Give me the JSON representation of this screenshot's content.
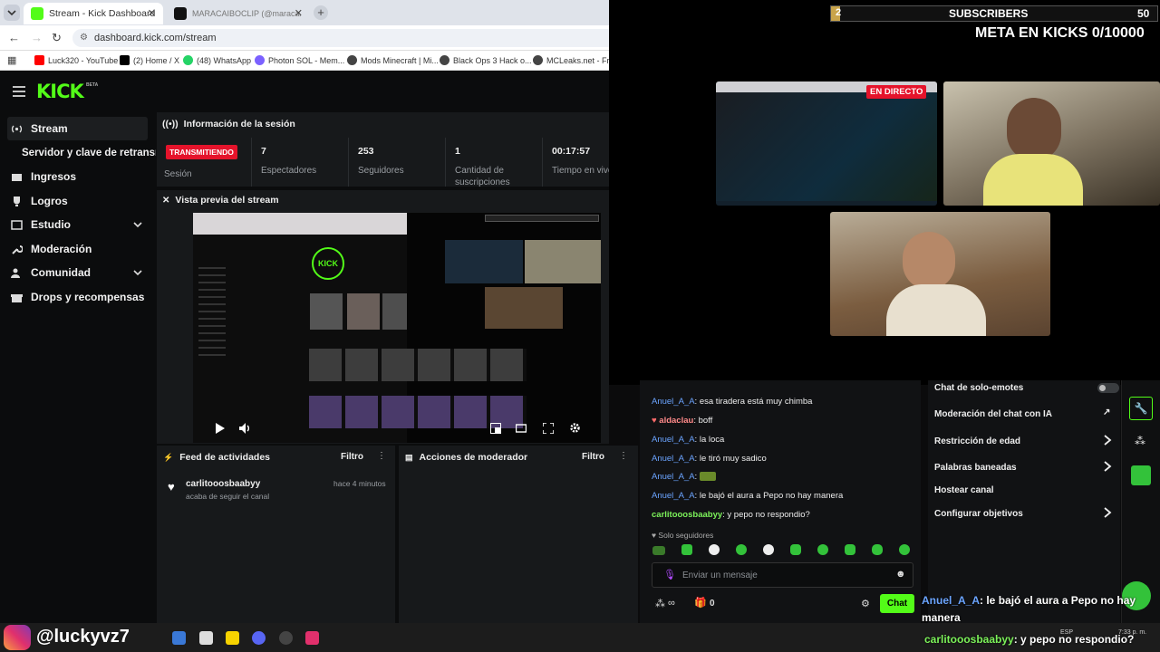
{
  "browser": {
    "tabs": [
      {
        "title": "Stream - Kick Dashboard"
      },
      {
        "title": "MARACAIBOCLIP (@maraca..."
      }
    ],
    "url": "dashboard.kick.com/stream",
    "bookmarks": [
      "Luck320 - YouTube",
      "(2) Home / X",
      "(48) WhatsApp",
      "Photon SOL - Mem...",
      "Mods Minecraft | Mi...",
      "Black Ops 3 Hack o...",
      "MCLeaks.net - Free..."
    ]
  },
  "sidebar": {
    "items": [
      {
        "label": "Stream"
      },
      {
        "label": "Servidor y clave de retransmisión"
      },
      {
        "label": "Ingresos"
      },
      {
        "label": "Logros"
      },
      {
        "label": "Estudio"
      },
      {
        "label": "Moderación"
      },
      {
        "label": "Comunidad"
      },
      {
        "label": "Drops y recompensas"
      }
    ]
  },
  "session": {
    "header": "Información de la sesión",
    "status_badge": "TRANSMITIENDO",
    "status_label": "Sesión",
    "viewers_value": "7",
    "viewers_label": "Espectadores",
    "followers_value": "253",
    "followers_label": "Seguidores",
    "subs_value": "1",
    "subs_label": "Cantidad de suscripciones",
    "time_value": "00:17:57",
    "time_label": "Tiempo en vivo"
  },
  "preview": {
    "header": "Vista previa del stream"
  },
  "feed": {
    "header": "Feed de actividades",
    "filter": "Filtro",
    "item_user": "carlitooosbaabyy",
    "item_time": "hace 4 minutos",
    "item_text": "acaba de seguir el canal"
  },
  "modactions": {
    "header": "Acciones de moderador",
    "filter": "Filtro"
  },
  "overlay": {
    "subs_count_left": "2",
    "subs_title": "SUBSCRIBERS",
    "subs_count_right": "50",
    "meta": "META EN KICKS 0/10000",
    "live_badge": "EN DIRECTO"
  },
  "chat": {
    "messages": [
      {
        "user": "Anuel_A_A",
        "text": "esa tiradera está muy chimba"
      },
      {
        "user": "aldaclau",
        "text": "boff"
      },
      {
        "user": "Anuel_A_A",
        "text": "la loca"
      },
      {
        "user": "Anuel_A_A",
        "text": "le tiró muy sadico"
      },
      {
        "user": "Anuel_A_A",
        "text": ""
      },
      {
        "user": "Anuel_A_A",
        "text": "le bajó el aura a Pepo no hay manera"
      },
      {
        "user": "carlitooosbaabyy",
        "text": "y pepo no respondio?"
      }
    ],
    "followers_only": "Solo seguidores",
    "input_placeholder": "Enviar un mensaje",
    "infinity": "∞",
    "gift_count": "0",
    "send_button": "Chat"
  },
  "modpanel": {
    "items": [
      {
        "label": "Chat de solo-emotes"
      },
      {
        "label": "Moderación del chat con IA"
      },
      {
        "label": "Restricción de edad"
      },
      {
        "label": "Palabras baneadas"
      },
      {
        "label": "Hostear canal"
      },
      {
        "label": "Configurar objetivos"
      }
    ]
  },
  "overlay_chat": {
    "line1_user": "Anuel_A_A",
    "line1_text": ": le bajó el aura a Pepo no hay manera",
    "line2_user": "carlitooosbaabyy",
    "line2_text": ": y pepo no respondio?"
  },
  "taskbar": {
    "watermark": "@luckyvz7",
    "lang": "ESP",
    "time": "7:33 p. m."
  },
  "colors": {
    "kick_green": "#53fc18",
    "live_red": "#e5132b"
  }
}
